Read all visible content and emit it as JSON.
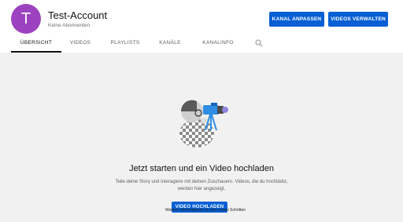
{
  "channel": {
    "avatar_letter": "T",
    "avatar_color": "#9c42c0",
    "name": "Test-Account",
    "subscribers": "Keine Abonnenten"
  },
  "actions": {
    "customize_label": "KANAL ANPASSEN",
    "manage_label": "VIDEOS VERWALTEN",
    "accent_color": "#065fd4"
  },
  "tabs": [
    {
      "label": "ÜBERSICHT",
      "active": true
    },
    {
      "label": "VIDEOS",
      "active": false
    },
    {
      "label": "PLAYLISTS",
      "active": false
    },
    {
      "label": "KANÄLE",
      "active": false
    },
    {
      "label": "KANALINFO",
      "active": false
    }
  ],
  "search_icon": "search-icon",
  "empty_state": {
    "title": "Jetzt starten und ein Video hochladen",
    "description": "Teile deine Story und interagiere mit deinen Zuschauern. Videos, die du hochlädst, werden hier angezeigt.",
    "upload_label": "VIDEO HOCHLADEN",
    "overlap_text": "Weitere Informationen zu den ersten Schritten"
  }
}
